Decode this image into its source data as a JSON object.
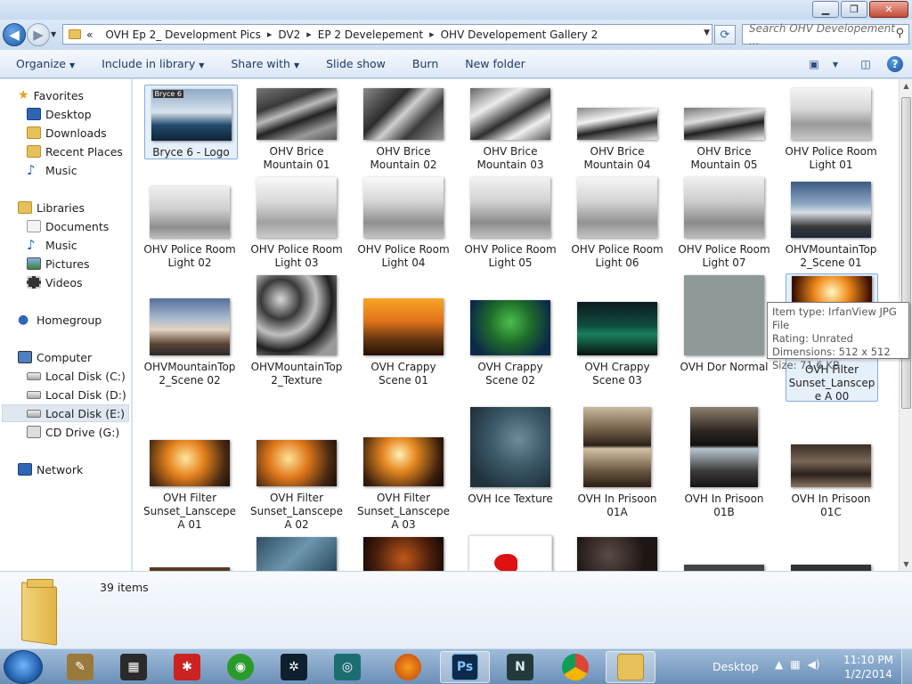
{
  "window": {
    "caption_buttons": {
      "minimize": "▁",
      "maximize": "❐",
      "close": "✕"
    }
  },
  "address": {
    "prefix": "«",
    "breadcrumb": [
      "OVH Ep 2_ Development Pics",
      "DV2",
      "EP 2 Develepement",
      "OHV Developement Gallery 2"
    ],
    "search_placeholder": "Search OHV Developement ..."
  },
  "toolbar": {
    "organize": "Organize",
    "include_in_library": "Include in library",
    "share_with": "Share with",
    "slide_show": "Slide show",
    "burn": "Burn",
    "new_folder": "New folder"
  },
  "sidebar": {
    "favorites": "Favorites",
    "favorites_items": [
      "Desktop",
      "Downloads",
      "Recent Places",
      "Music"
    ],
    "libraries": "Libraries",
    "libraries_items": [
      "Documents",
      "Music",
      "Pictures",
      "Videos"
    ],
    "homegroup": "Homegroup",
    "computer": "Computer",
    "computer_items": [
      "Local Disk (C:)",
      "Local Disk (D:)",
      "Local Disk (E:)",
      "CD Drive (G:)"
    ],
    "network": "Network",
    "selected": "Local Disk (E:)"
  },
  "files": [
    {
      "label": "Bryce 6 - Logo",
      "overlay": "Bryce 6"
    },
    {
      "label": "OHV Brice Mountain 01"
    },
    {
      "label": "OHV Brice Mountain 02"
    },
    {
      "label": "OHV Brice Mountain 03"
    },
    {
      "label": "OHV Brice Mountain 04"
    },
    {
      "label": "OHV Brice Mountain 05"
    },
    {
      "label": "OHV Police Room Light 01"
    },
    {
      "label": "OHV Police Room Light 02"
    },
    {
      "label": "OHV Police Room Light 03"
    },
    {
      "label": "OHV Police Room Light 04"
    },
    {
      "label": "OHV Police Room Light 05"
    },
    {
      "label": "OHV Police Room Light 06"
    },
    {
      "label": "OHV Police Room Light 07"
    },
    {
      "label": "OHVMountainTop 2_Scene 01"
    },
    {
      "label": "OHVMountainTop 2_Scene 02"
    },
    {
      "label": "OHVMountainTop 2_Texture"
    },
    {
      "label": "OVH Crappy Scene 01"
    },
    {
      "label": "OVH Crappy Scene 02"
    },
    {
      "label": "OVH Crappy Scene 03"
    },
    {
      "label": "OVH Dor Normal"
    },
    {
      "label": "OVH Filter Sunset_Lanscepe A 00"
    },
    {
      "label": "OVH Filter Sunset_Lanscepe A 01"
    },
    {
      "label": "OVH Filter Sunset_Lanscepe A 02"
    },
    {
      "label": "OVH Filter Sunset_Lanscepe A 03"
    },
    {
      "label": "OVH Ice Texture"
    },
    {
      "label": "OVH In Prisoon 01A"
    },
    {
      "label": "OVH In Prisoon 01B"
    },
    {
      "label": "OVH In Prisoon 01C"
    }
  ],
  "tooltip": {
    "line1": "Item type: IrfanView JPG File",
    "line2": "Rating: Unrated",
    "line3": "Dimensions: 512 x 512",
    "line4": "Size: 71.6 KB"
  },
  "details": {
    "count": "39 items"
  },
  "taskbar": {
    "desktop": "Desktop",
    "time": "11:10 PM",
    "date": "1/2/2014",
    "ps_label": "Ps",
    "max_label": "N"
  }
}
